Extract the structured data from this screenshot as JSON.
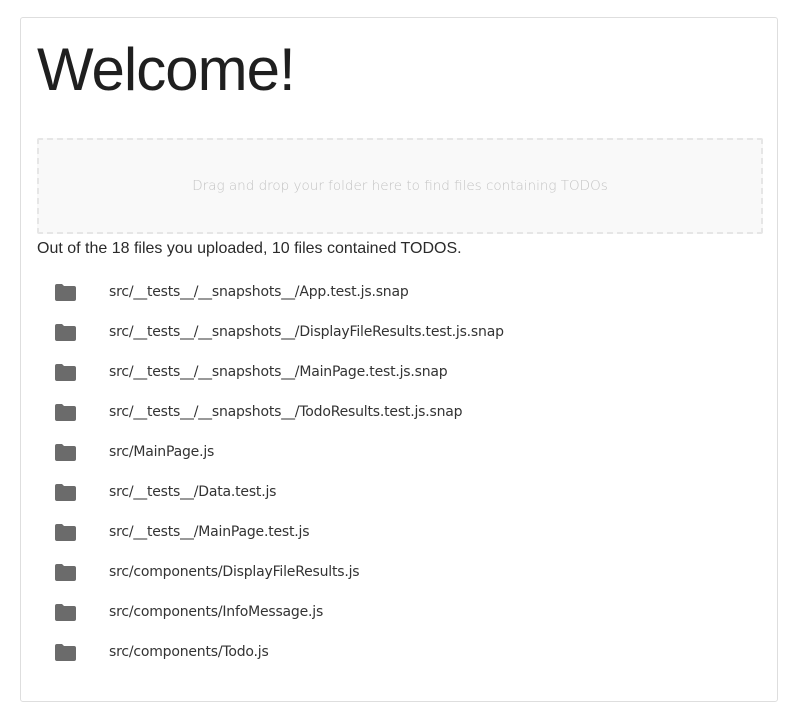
{
  "header": {
    "title": "Welcome!"
  },
  "dropzone": {
    "text": "Drag and drop your folder here to find files containing TODOs"
  },
  "summary": {
    "text": "Out of the 18 files you uploaded, 10 files contained TODOS."
  },
  "colors": {
    "folder_icon": "#6b6b6b",
    "dropzone_bg": "#f9f9f9",
    "dropzone_border": "#e6e6e6"
  },
  "files": [
    {
      "icon": "folder-icon",
      "path": "src/__tests__/__snapshots__/App.test.js.snap"
    },
    {
      "icon": "folder-icon",
      "path": "src/__tests__/__snapshots__/DisplayFileResults.test.js.snap"
    },
    {
      "icon": "folder-icon",
      "path": "src/__tests__/__snapshots__/MainPage.test.js.snap"
    },
    {
      "icon": "folder-icon",
      "path": "src/__tests__/__snapshots__/TodoResults.test.js.snap"
    },
    {
      "icon": "folder-icon",
      "path": "src/MainPage.js"
    },
    {
      "icon": "folder-icon",
      "path": "src/__tests__/Data.test.js"
    },
    {
      "icon": "folder-icon",
      "path": "src/__tests__/MainPage.test.js"
    },
    {
      "icon": "folder-icon",
      "path": "src/components/DisplayFileResults.js"
    },
    {
      "icon": "folder-icon",
      "path": "src/components/InfoMessage.js"
    },
    {
      "icon": "folder-icon",
      "path": "src/components/Todo.js"
    }
  ]
}
